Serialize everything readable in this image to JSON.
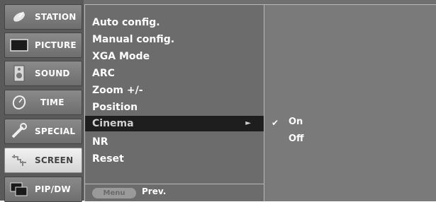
{
  "tabs": [
    {
      "label": "STATION",
      "icon": "satellite-dish-icon",
      "active": false
    },
    {
      "label": "PICTURE",
      "icon": "tv-screen-icon",
      "active": false
    },
    {
      "label": "SOUND",
      "icon": "speaker-icon",
      "active": false
    },
    {
      "label": "TIME",
      "icon": "clock-icon",
      "active": false
    },
    {
      "label": "SPECIAL",
      "icon": "wrench-icon",
      "active": false
    },
    {
      "label": "SCREEN",
      "icon": "screen-adjust-icon",
      "active": true
    },
    {
      "label": "PIP/DW",
      "icon": "picture-in-picture-icon",
      "active": false
    }
  ],
  "menu": {
    "items": [
      "Auto config.",
      "Manual config.",
      "XGA Mode",
      "ARC",
      "Zoom +/-",
      "Position",
      "Cinema",
      "NR",
      "Reset"
    ],
    "selected_index": 6,
    "selected_arrow": "►",
    "footer_button": "Menu",
    "footer_label": "Prev."
  },
  "submenu": {
    "options": [
      "On",
      "Off"
    ],
    "checked": "On",
    "check_mark": "✔"
  },
  "colors": {
    "background": "#707070",
    "selected_row": "#1e1e1e",
    "active_tab": "#e6e6e6"
  }
}
